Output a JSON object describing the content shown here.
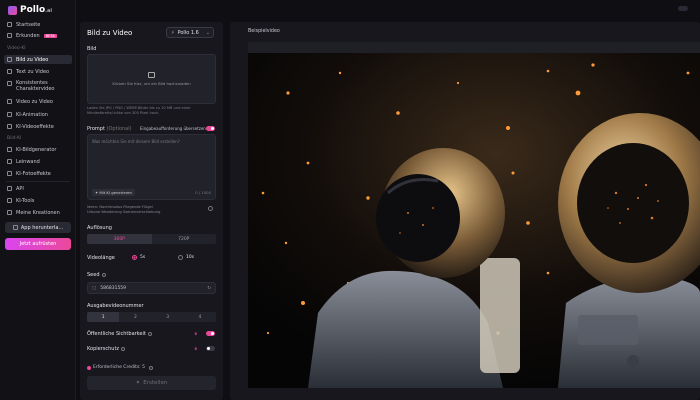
{
  "brand": {
    "name": "Pollo",
    "suffix": ".ai"
  },
  "sidebar": {
    "top": [
      {
        "label": "Startseite",
        "icon": "home-icon"
      },
      {
        "label": "Erkunden",
        "badge": "BETA",
        "icon": "compass-icon"
      }
    ],
    "section_video": "Video-KI",
    "video_items": [
      {
        "label": "Bild zu Video",
        "active": true,
        "icon": "image-icon"
      },
      {
        "label": "Text zu Video",
        "icon": "text-icon"
      },
      {
        "label": "Konsistentes Charaktervideo",
        "icon": "user-icon"
      },
      {
        "label": "Video zu Video",
        "icon": "video-icon"
      },
      {
        "label": "KI-Animation",
        "icon": "sparkle-icon"
      },
      {
        "label": "KI-Videoeffekte",
        "icon": "magic-icon"
      }
    ],
    "section_image": "Bild-KI",
    "image_items": [
      {
        "label": "KI-Bildgenerator",
        "icon": "picture-icon"
      },
      {
        "label": "Leinwand",
        "icon": "canvas-icon"
      },
      {
        "label": "KI-Fotoeffekte",
        "icon": "effects-icon"
      }
    ],
    "bottom_items": [
      {
        "label": "API",
        "icon": "code-icon"
      },
      {
        "label": "KI-Tools",
        "icon": "tools-icon"
      },
      {
        "label": "Meine Kreationen",
        "icon": "folder-icon"
      }
    ],
    "app_button": "App herunterla...",
    "upgrade_button": "Jetzt aufrüsten"
  },
  "panel": {
    "title": "Bild zu Video",
    "model": "Pollo 1.6",
    "image_label": "Bild",
    "upload_text": "Klicken Sie hier, um ein Bild hochzuladen",
    "upload_hint": "Laden Sie JPG / PNG / WEBP-Bilder bis zu 10 MB und einer Mindestbreite/-höhe von 300 Pixel hoch.",
    "prompt_label": "Prompt",
    "prompt_optional": "(Optional)",
    "translate_label": "Eingabeaufforderung übersetzen",
    "prompt_placeholder": "Was möchten Sie mit diesem Bild erstellen?",
    "ai_button": "Mit KI generieren",
    "counter": "0 / 1500",
    "ideas_line1": "Ideen:   Nachtmodus   Fliegende Flügel",
    "ideas_line2": "Urbane Wanderung   Szenenverschiebung",
    "resolution_label": "Auflösung",
    "res_options": [
      "360P",
      "720P"
    ],
    "length_label": "Videolänge",
    "length_options": [
      "5s",
      "10s"
    ],
    "seed_label": "Seed",
    "seed_value": "586831559",
    "output_label": "Ausgabevideonummer",
    "output_options": [
      "1",
      "2",
      "3",
      "4"
    ],
    "public_label": "Öffentliche Sichtbarkeit",
    "copy_label": "Kopierschutz",
    "credits": "Erforderliche Credits: 5",
    "create_button": "Erstellen"
  },
  "preview": {
    "label": "Beispielvideo"
  }
}
